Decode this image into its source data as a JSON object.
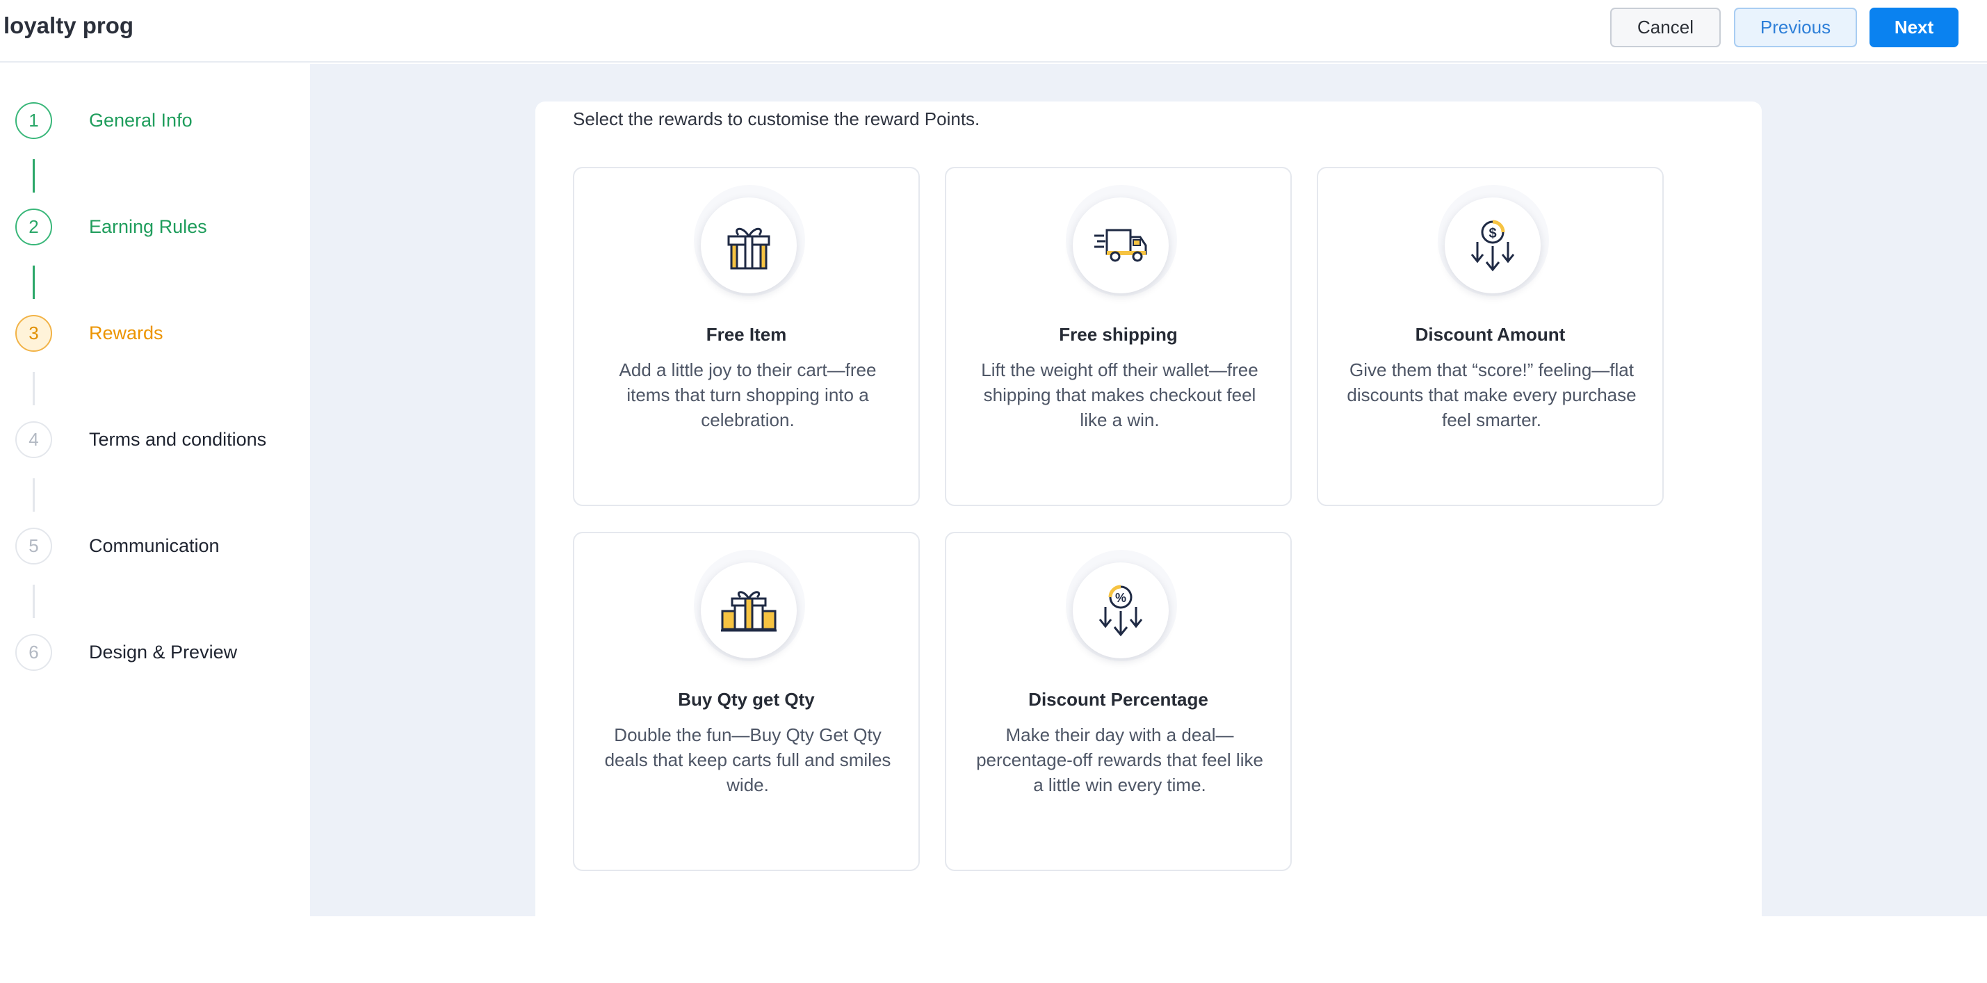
{
  "header": {
    "title": "loyalty prog",
    "cancel_label": "Cancel",
    "previous_label": "Previous",
    "next_label": "Next"
  },
  "steps": [
    {
      "number": "1",
      "label": "General Info",
      "status": "done"
    },
    {
      "number": "2",
      "label": "Earning Rules",
      "status": "done"
    },
    {
      "number": "3",
      "label": "Rewards",
      "status": "active"
    },
    {
      "number": "4",
      "label": "Terms and conditions",
      "status": "todo"
    },
    {
      "number": "5",
      "label": "Communication",
      "status": "todo"
    },
    {
      "number": "6",
      "label": "Design & Preview",
      "status": "todo"
    }
  ],
  "main": {
    "instruction": "Select the rewards to customise the reward Points.",
    "rewards": [
      {
        "icon": "gift-icon",
        "title": "Free Item",
        "description": "Add a little joy to their cart—free items that turn shopping into a celebration."
      },
      {
        "icon": "delivery-truck-icon",
        "title": "Free shipping",
        "description": "Lift the weight off their wallet—free shipping that makes checkout feel like a win."
      },
      {
        "icon": "dollar-coin-down-arrows-icon",
        "title": "Discount Amount",
        "description": "Give them that “score!” feeling—flat discounts that make every purchase feel smarter."
      },
      {
        "icon": "gift-boxes-icon",
        "title": "Buy Qty get Qty",
        "description": "Double the fun—Buy Qty Get Qty deals that keep carts full and smiles wide."
      },
      {
        "icon": "percent-coin-down-arrows-icon",
        "title": "Discount Percentage",
        "description": "Make their day with a deal—percentage-off rewards that feel like a little win every time."
      }
    ]
  },
  "colors": {
    "accent_blue": "#0a82f0",
    "done_green": "#2aa768",
    "active_orange": "#ec9400",
    "main_background": "#edf1f8",
    "icon_yellow": "#f6c342",
    "icon_navy": "#1f2a44"
  }
}
